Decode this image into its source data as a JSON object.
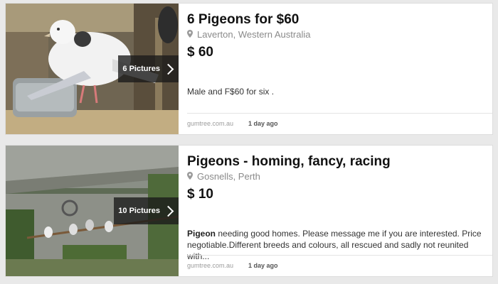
{
  "listings": [
    {
      "title": "6 Pigeons for $60",
      "location": "Laverton, Western Australia",
      "price": "$ 60",
      "pictures": "6 Pictures",
      "desc_bold": "",
      "description": "Male and F$60 for six .",
      "source": "gumtree.com.au",
      "posted": "1 day ago"
    },
    {
      "title": "Pigeons - homing, fancy, racing",
      "location": "Gosnells, Perth",
      "price": "$ 10",
      "pictures": "10 Pictures",
      "desc_bold": "Pigeon",
      "description": " needing good homes. Please message me if you are interested. Price negotiable.Different breeds and colours, all rescued and sadly not reunited with...",
      "source": "gumtree.com.au",
      "posted": "1 day ago"
    }
  ],
  "icons": {
    "location": "map-pin-icon",
    "next": "chevron-right-icon"
  }
}
